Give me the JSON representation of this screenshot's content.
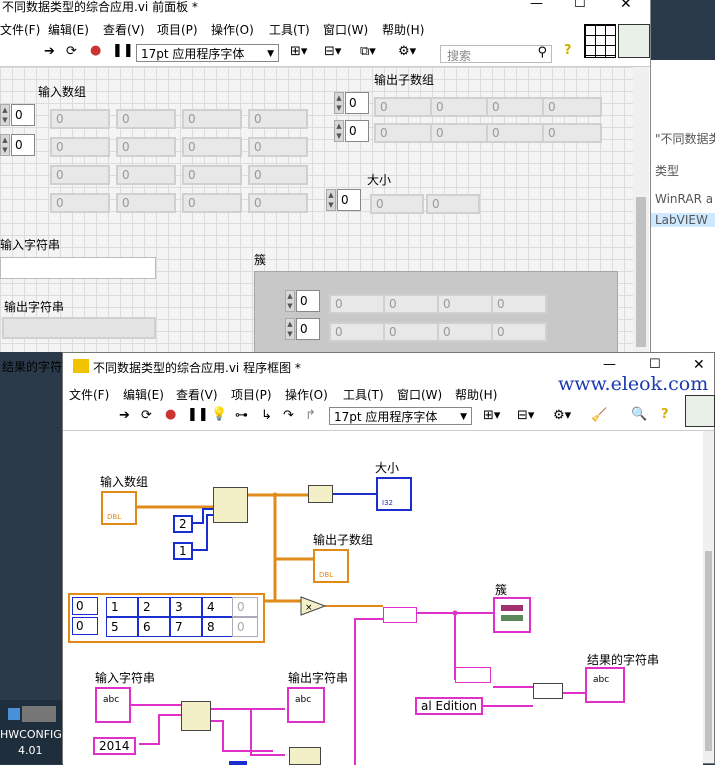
{
  "front_panel": {
    "title": "不同数据类型的综合应用.vi 前面板 *",
    "menu": [
      "文件(F)",
      "编辑(E)",
      "查看(V)",
      "项目(P)",
      "操作(O)",
      "工具(T)",
      "窗口(W)",
      "帮助(H)"
    ],
    "font_selector": "17pt 应用程序字体",
    "search_placeholder": "搜索",
    "input_array_label": "输入数组",
    "input_array_indices": [
      "0",
      "0"
    ],
    "input_array_values": [
      [
        "0",
        "0",
        "0",
        "0"
      ],
      [
        "0",
        "0",
        "0",
        "0"
      ],
      [
        "0",
        "0",
        "0",
        "0"
      ],
      [
        "0",
        "0",
        "0",
        "0"
      ]
    ],
    "output_subarray_label": "输出子数组",
    "output_subarray_indices": [
      "0",
      "0"
    ],
    "output_subarray_values": [
      [
        "0",
        "0",
        "0",
        "0"
      ],
      [
        "0",
        "0",
        "0",
        "0"
      ]
    ],
    "size_label": "大小",
    "size_index": "0",
    "size_values": [
      "0",
      "0"
    ],
    "input_string_label": "输入字符串",
    "output_string_label": "输出字符串",
    "cluster_label": "簇",
    "cluster_indices": [
      "0",
      "0"
    ],
    "cluster_values": [
      [
        "0",
        "0",
        "0",
        "0"
      ],
      [
        "0",
        "0",
        "0",
        "0"
      ]
    ],
    "result_string_label": "结果的字符"
  },
  "explorer": {
    "heading": "\"不同数据类",
    "column_type": "类型",
    "row1": "WinRAR a",
    "row2": "LabVIEW"
  },
  "taskbar": {
    "item_name": "HWCONFIG",
    "item_version": "4.01"
  },
  "block_diagram": {
    "title": "不同数据类型的综合应用.vi 程序框图 *",
    "menu": [
      "文件(F)",
      "编辑(E)",
      "查看(V)",
      "项目(P)",
      "操作(O)",
      "工具(T)",
      "窗口(W)",
      "帮助(H)"
    ],
    "font_selector": "17pt 应用程序字体",
    "watermark": "www.eleok.com",
    "input_array_label": "输入数组",
    "size_label": "大小",
    "output_subarray_label": "输出子数组",
    "cluster_label": "簇",
    "input_string_label": "输入字符串",
    "output_string_label": "输出字符串",
    "result_string_label": "结果的字符串",
    "const_2": "2",
    "const_1": "1",
    "array_const_indices": [
      "0",
      "0"
    ],
    "array_const_rows": [
      [
        "1",
        "2",
        "3",
        "4",
        "0"
      ],
      [
        "5",
        "6",
        "7",
        "8",
        "0"
      ]
    ],
    "string_const_edition": "al Edition",
    "string_const_2014": "2014",
    "terminal_type_i32": "I32",
    "terminal_type_dbl": "DBL",
    "terminal_type_abc": "abc"
  },
  "colors": {
    "wire_orange": "#e08a18",
    "wire_blue": "#1a2ecf",
    "wire_pink": "#e030c8",
    "watermark": "#1a3ab0"
  }
}
